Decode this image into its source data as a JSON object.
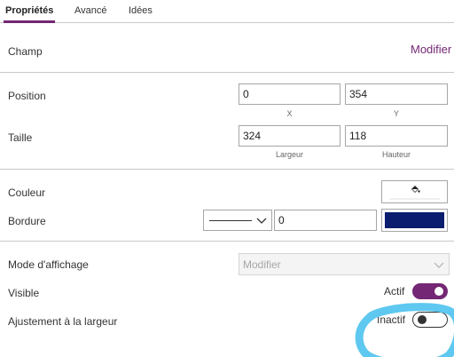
{
  "tabs": [
    {
      "label": "Propriétés",
      "active": true
    },
    {
      "label": "Avancé",
      "active": false
    },
    {
      "label": "Idées",
      "active": false
    }
  ],
  "field": {
    "label": "Champ",
    "action": "Modifier"
  },
  "position": {
    "label": "Position",
    "x_value": "0",
    "y_value": "354",
    "x_caption": "X",
    "y_caption": "Y"
  },
  "size": {
    "label": "Taille",
    "width_value": "324",
    "height_value": "118",
    "width_caption": "Largeur",
    "height_caption": "Hauteur"
  },
  "color": {
    "label": "Couleur",
    "icon": "paint-bucket-icon"
  },
  "border": {
    "label": "Bordure",
    "style": "solid",
    "width_value": "0",
    "color": "#0b1d6e"
  },
  "display_mode": {
    "label": "Mode d'affichage",
    "value": "Modifier"
  },
  "visible": {
    "label": "Visible",
    "state_label": "Actif",
    "on": true
  },
  "fit_width": {
    "label": "Ajustement à la largeur",
    "state_label": "Inactif",
    "on": false
  },
  "colors": {
    "accent": "#742774",
    "annotation": "#5ec8f0"
  }
}
